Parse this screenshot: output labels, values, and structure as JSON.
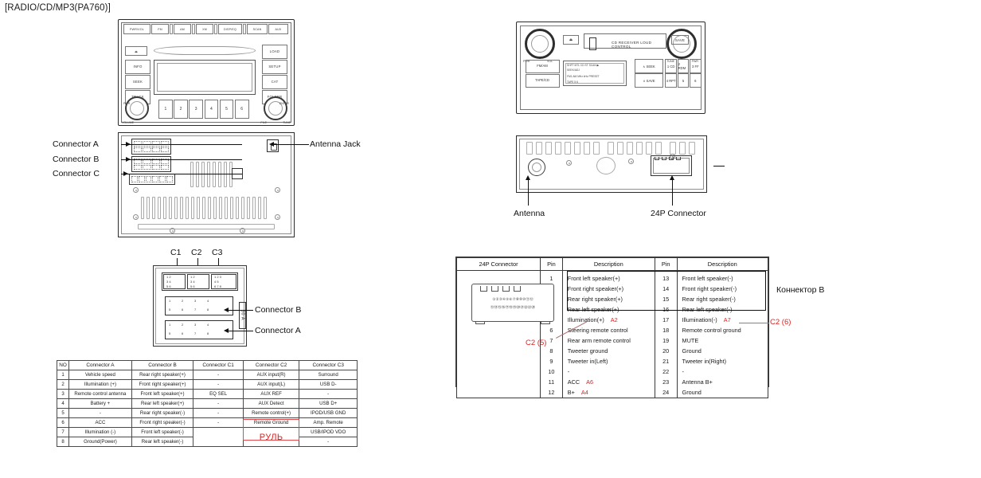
{
  "page": {
    "title": "[RADIO/CD/MP3(PA760)]"
  },
  "radio_front_left": {
    "name": "radio-cd-mp3-head-unit-front",
    "top_buttons": [
      "PWR/VOL",
      "FM",
      "AM",
      "XM",
      "DISP/EQ",
      "SCAN",
      "AUX"
    ],
    "eject_label": "⏏",
    "left_buttons": [
      "INFO",
      "SEEK",
      "TRACK"
    ],
    "right_buttons": [
      "LOAD",
      "SETUP",
      "CAT",
      "FOLDER"
    ],
    "left_knob_labels": {
      "top": "PWR",
      "bottom": "VOLUME"
    },
    "right_knob_labels": {
      "top": "ENTER",
      "bottom_left": "FILE",
      "bottom_right": "TUNE"
    },
    "presets": [
      "1",
      "2",
      "3",
      "4",
      "5",
      "6"
    ]
  },
  "rear_panel_left": {
    "name": "head-unit-rear-panel",
    "callouts": [
      {
        "label": "Connector A"
      },
      {
        "label": "Connector B"
      },
      {
        "label": "Connector C"
      },
      {
        "label": "Antenna Jack"
      }
    ]
  },
  "connector_block": {
    "name": "connector-pin-layout",
    "top_labels": [
      "C1",
      "C2",
      "C3"
    ],
    "side_labels": [
      "Connector B",
      "Connector A"
    ],
    "fuse_label": "30 A",
    "rows_top": [
      "1 2",
      "3 4",
      "5 6"
    ],
    "pins_b": [
      "1",
      "2",
      "3",
      "4",
      "5",
      "6",
      "7",
      "8"
    ],
    "pins_a": [
      "1",
      "2",
      "3",
      "4",
      "5",
      "6",
      "7",
      "8"
    ]
  },
  "left_table": {
    "name": "connector-pinout-table",
    "headers": [
      "NO",
      "Connector A",
      "Connector B",
      "Connector C1",
      "Connector C2",
      "Connector C3"
    ],
    "rows": [
      [
        "1",
        "Vehicle speed",
        "Rear right speaker(+)",
        "-",
        "AUX input(R)",
        "Surround"
      ],
      [
        "2",
        "Illumination (+)",
        "Front right speaker(+)",
        "-",
        "AUX input(L)",
        "USB D-"
      ],
      [
        "3",
        "Remote control antenna",
        "Front left speaker(+)",
        "EQ SEL",
        "AUX REF",
        "-"
      ],
      [
        "4",
        "Battery +",
        "Rear left speaker(+)",
        "-",
        "AUX Detect",
        "USB D+"
      ],
      [
        "5",
        "-",
        "Rear right speaker(-)",
        "-",
        "Remote control(+)",
        "IPOD/USB GND"
      ],
      [
        "6",
        "ACC",
        "Front right speaker(-)",
        "-",
        "Remote Ground",
        "Amp. Remote"
      ],
      [
        "7",
        "Illumination (-)",
        "Front left speaker(-)",
        "",
        "",
        "USB/IPOD VDO"
      ],
      [
        "8",
        "Ground(Power)",
        "Rear left speaker(-)",
        "",
        "РУЛЬ",
        "-"
      ]
    ],
    "highlight_color": "#e04a4a",
    "ruble_label": "РУЛЬ",
    "ruble_color": "#e02020"
  },
  "radio_front_right": {
    "name": "alternate-head-unit-front",
    "left_knob_labels": {
      "left": "PWR",
      "right": "VOL"
    },
    "right_knob_labels": {
      "left": "TUNE",
      "right": "PWR"
    },
    "cd_bay_text": "CD RECEIVER    LOUD CONTROL",
    "eject_label": "⏏",
    "save_button": "SAVE",
    "left_buttons": [
      "FM/AM",
      "TAPE/CD"
    ],
    "seek_buttons": [
      "∧ SEEK",
      "∨ SAVE"
    ],
    "preset_buttons": [
      "1 CD",
      "2 RDM",
      "3 FF",
      "4 RPT",
      "5",
      "6"
    ],
    "lcd_lines": [
      "SHFT  MTL  CD  ST  SCAN  ▶",
      "SEEK/ADJ",
      "FM1  AM  MHz  kHz  PRESET",
      "TAPE          5 6"
    ]
  },
  "rear_panel_right": {
    "name": "alternate-head-unit-rear",
    "callouts": [
      {
        "label": "Antenna"
      },
      {
        "label": "24P Connector"
      }
    ]
  },
  "table_24p": {
    "name": "24p-connector-table",
    "headers": [
      "24P Connector",
      "Pin",
      "Description",
      "Pin",
      "Description"
    ],
    "left_pins": [
      "1",
      "2",
      "3",
      "4",
      "5",
      "6",
      "7",
      "8",
      "9",
      "10",
      "11",
      "12"
    ],
    "left_desc": [
      "Front left speaker(+)",
      "Front right speaker(+)",
      "Rear right speaker(+)",
      "Rear left speaker(+)",
      "Illumination(+)",
      "Steering remote control",
      "Rear arm remote control",
      "Tweeter ground",
      "Tweeter in(Left)",
      "-",
      "ACC",
      "B+"
    ],
    "left_annot": [
      "",
      "",
      "",
      "",
      "A2",
      "",
      "",
      "",
      "",
      "",
      "A6",
      "A4"
    ],
    "right_pins": [
      "13",
      "14",
      "15",
      "16",
      "17",
      "18",
      "19",
      "20",
      "21",
      "22",
      "23",
      "24"
    ],
    "right_desc": [
      "Front left speaker(-)",
      "Front right speaker(-)",
      "Rear right speaker(-)",
      "Rear left speaker(-)",
      "Illumination(-)",
      "Remote control ground",
      "MUTE",
      "Ground",
      "Tweeter in(Right)",
      "-",
      "Antenna B+",
      "Ground"
    ],
    "right_annot": [
      "",
      "",
      "",
      "",
      "A7",
      "",
      "",
      "",
      "",
      "",
      "",
      ""
    ],
    "illus_pins_row1": "①②③④⑤⑥⑦⑧⑨⑩⑪⑫",
    "illus_pins_row2": "⑬⑭⑮⑯⑰⑱⑲⑳㉑㉒㉓㉔",
    "annotation_c2_5": "C2 (5)",
    "annotation_c2_6": "C2 (6)",
    "annotation_konnektor_b": "Коннектор B",
    "annot_color": "#e02020"
  }
}
